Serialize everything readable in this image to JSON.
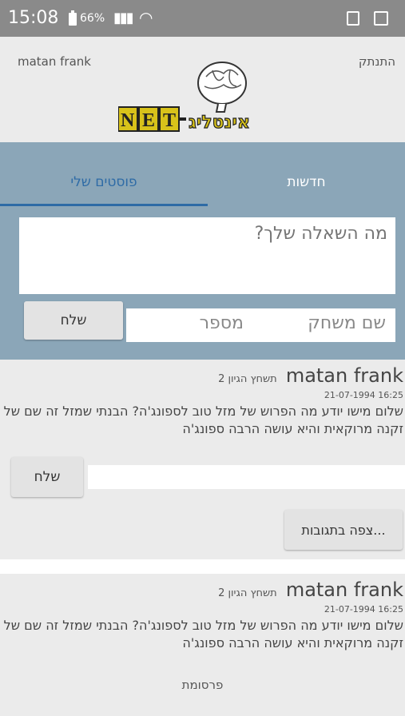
{
  "status_bar": {
    "time": "15:08",
    "battery_percent": "66%",
    "icons": [
      "battery-icon",
      "signal-icon",
      "wifi-icon",
      "screenshot-icon",
      "gallery-icon"
    ]
  },
  "header": {
    "username": "matan frank",
    "logout": "התנתק",
    "logo_text": "NET-אינטליג"
  },
  "tabs": [
    {
      "label": "פוסטים שלי",
      "active": true
    },
    {
      "label": "חדשות",
      "active": false
    }
  ],
  "composer": {
    "question_placeholder": "מה השאלה שלך?",
    "nickname_placeholder": "שם משחק",
    "number_placeholder": "מספר",
    "send_label": "שלח"
  },
  "posts": [
    {
      "author": "matan frank",
      "type": "תשחץ הגיון 2",
      "date": "21-07-1994 16:25",
      "body": "שלום מישו יודע מה הפרוש של מזל טוב לספונג'ה? הבנתי שמזל זה שם של זקנה מרוקאית והיא עושה הרבה ספונג'ה",
      "reply_send_label": "שלח",
      "view_replies_label": "צפה בתגובות..."
    },
    {
      "author": "matan frank",
      "type": "תשחץ הגיון 2",
      "date": "21-07-1994 16:25",
      "body": "שלום מישו יודע מה הפרוש של מזל טוב לספונג'ה? הבנתי שמזל זה שם של זקנה מרוקאית והיא עושה הרבה ספונג'ה"
    }
  ],
  "ad_label": "פרסומת",
  "colors": {
    "panel": "#8ba6b8",
    "active_tab": "#2e6ba6",
    "background": "#ebebeb"
  }
}
